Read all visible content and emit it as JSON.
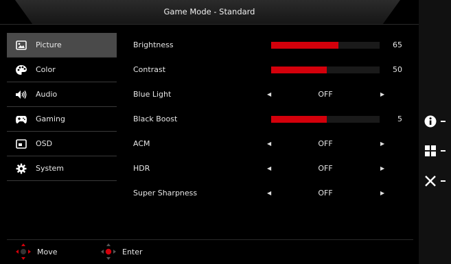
{
  "osd": {
    "title": "Game Mode - Standard",
    "menu": [
      {
        "label": "Picture",
        "icon": "picture-icon",
        "active": true
      },
      {
        "label": "Color",
        "icon": "palette-icon",
        "active": false
      },
      {
        "label": "Audio",
        "icon": "speaker-icon",
        "active": false
      },
      {
        "label": "Gaming",
        "icon": "gamepad-icon",
        "active": false
      },
      {
        "label": "OSD",
        "icon": "osd-icon",
        "active": false
      },
      {
        "label": "System",
        "icon": "gear-icon",
        "active": false
      }
    ],
    "settings": [
      {
        "label": "Brightness",
        "type": "slider",
        "value": "65",
        "level": 0.62
      },
      {
        "label": "Contrast",
        "type": "slider",
        "value": "50",
        "level": 0.51
      },
      {
        "label": "Blue Light",
        "type": "select",
        "value": "OFF"
      },
      {
        "label": "Black Boost",
        "type": "slider",
        "value": "5",
        "level": 0.51
      },
      {
        "label": "ACM",
        "type": "select",
        "value": "OFF"
      },
      {
        "label": "HDR",
        "type": "select",
        "value": "OFF"
      },
      {
        "label": "Super Sharpness",
        "type": "select",
        "value": "OFF"
      }
    ],
    "hints": {
      "move_label": "Move",
      "enter_label": "Enter"
    },
    "hotkeys": [
      {
        "icon": "info-icon"
      },
      {
        "icon": "grid-icon"
      },
      {
        "icon": "close-icon"
      }
    ],
    "colors": {
      "accent": "#d4000b",
      "active_menu_bg": "#4a4a4a"
    }
  }
}
